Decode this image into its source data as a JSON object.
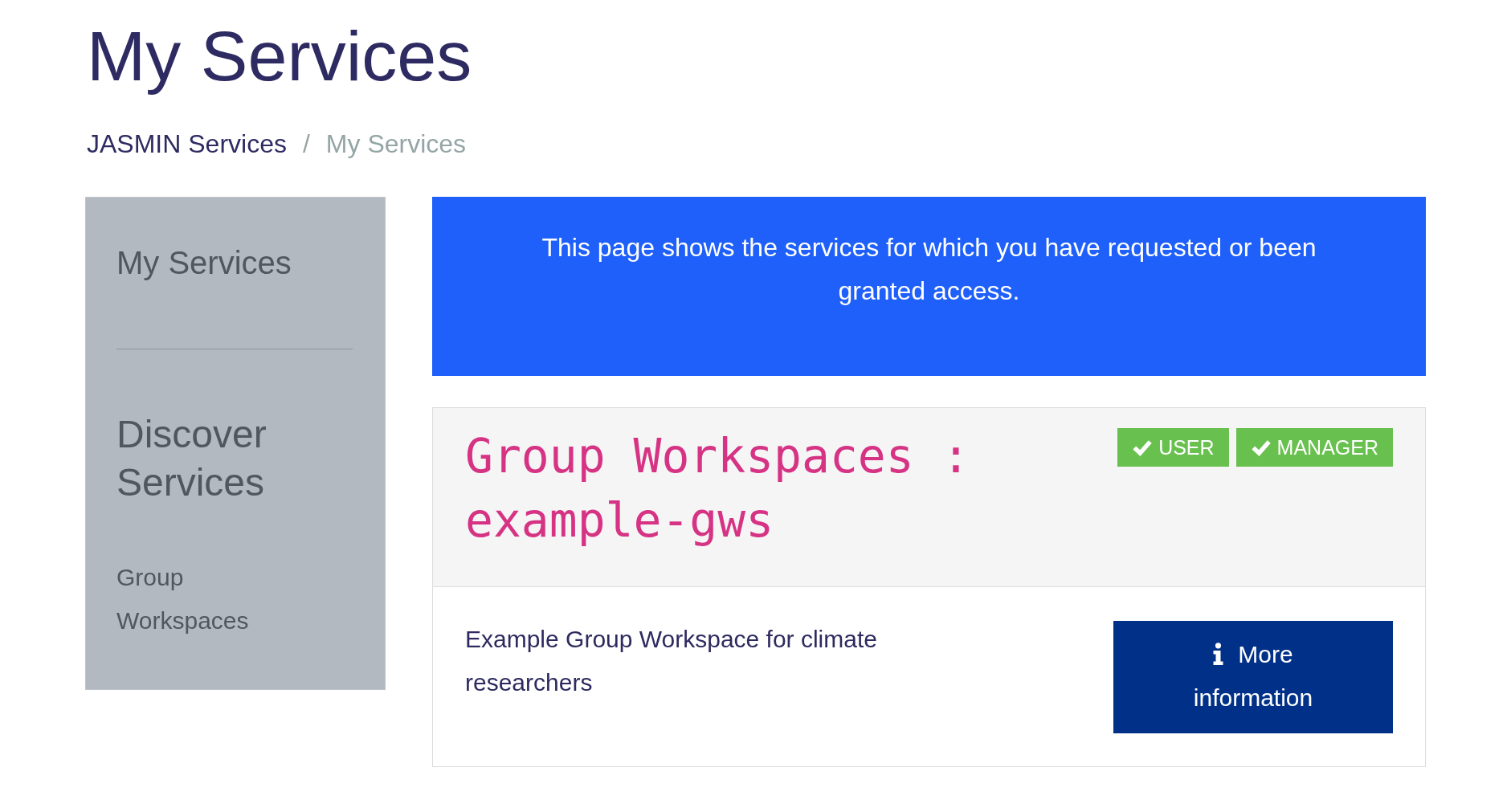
{
  "page_title": "My Services",
  "breadcrumb": {
    "items": [
      {
        "label": "JASMIN Services",
        "current": false
      },
      {
        "label": "My Services",
        "current": true
      }
    ],
    "separator": "/"
  },
  "sidebar": {
    "items": [
      {
        "kind": "primary",
        "label": "My Services"
      },
      {
        "kind": "divider"
      },
      {
        "kind": "heading",
        "label": "Discover Services"
      },
      {
        "kind": "link",
        "label": "Group Workspaces"
      }
    ]
  },
  "banner": {
    "text": "This page shows the services for which you have requested or been granted access."
  },
  "services": [
    {
      "title": "Group Workspaces : example-gws",
      "roles": [
        {
          "label": "USER"
        },
        {
          "label": "MANAGER"
        }
      ],
      "description": "Example Group Workspace for climate researchers",
      "button": {
        "label": "More information"
      }
    }
  ]
}
